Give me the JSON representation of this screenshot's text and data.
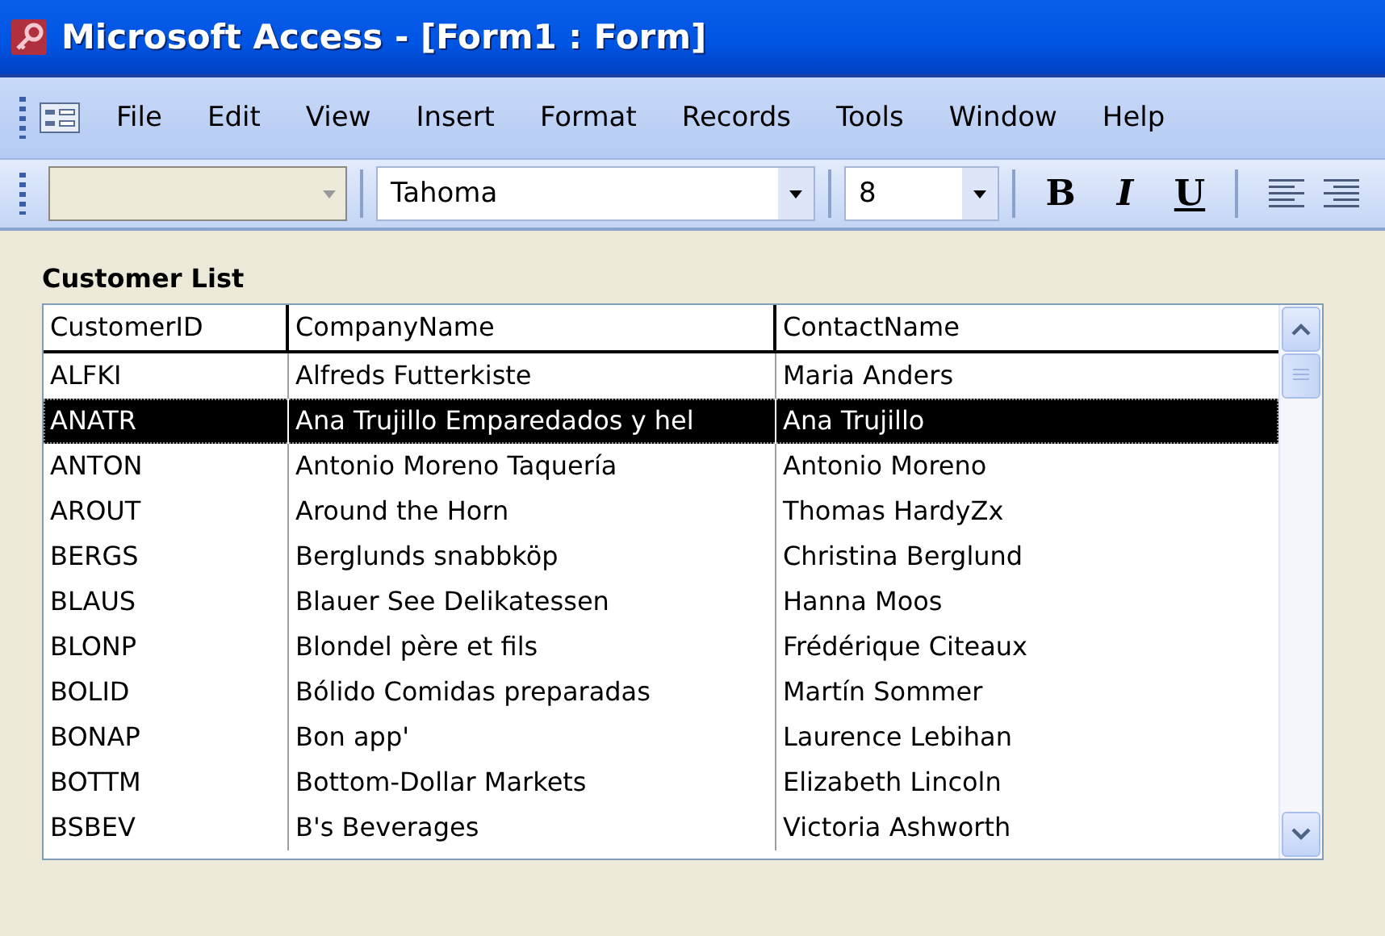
{
  "window": {
    "title": "Microsoft Access - [Form1 : Form]"
  },
  "menu": [
    "File",
    "Edit",
    "View",
    "Insert",
    "Format",
    "Records",
    "Tools",
    "Window",
    "Help"
  ],
  "toolbar": {
    "font_name": "Tahoma",
    "font_size": "8",
    "format_buttons": [
      {
        "label": "B",
        "kind": "bold"
      },
      {
        "label": "I",
        "kind": "italic"
      },
      {
        "label": "U",
        "kind": "underline"
      }
    ]
  },
  "form": {
    "label": "Customer List",
    "list": {
      "columns": [
        "CustomerID",
        "CompanyName",
        "ContactName"
      ],
      "rows": [
        {
          "cells": [
            "ALFKI",
            "Alfreds Futterkiste",
            "Maria Anders"
          ],
          "selected": false
        },
        {
          "cells": [
            "ANATR",
            "Ana Trujillo Emparedados y hel",
            "Ana Trujillo"
          ],
          "selected": true
        },
        {
          "cells": [
            "ANTON",
            "Antonio Moreno Taquería",
            "Antonio Moreno"
          ],
          "selected": false
        },
        {
          "cells": [
            "AROUT",
            "Around the Horn",
            "Thomas HardyZx"
          ],
          "selected": false
        },
        {
          "cells": [
            "BERGS",
            "Berglunds snabbköp",
            "Christina Berglund"
          ],
          "selected": false
        },
        {
          "cells": [
            "BLAUS",
            "Blauer See Delikatessen",
            "Hanna Moos"
          ],
          "selected": false
        },
        {
          "cells": [
            "BLONP",
            "Blondel père et fils",
            "Frédérique Citeaux"
          ],
          "selected": false
        },
        {
          "cells": [
            "BOLID",
            "Bólido Comidas preparadas",
            "Martín Sommer"
          ],
          "selected": false
        },
        {
          "cells": [
            "BONAP",
            "Bon app'",
            "Laurence Lebihan"
          ],
          "selected": false
        },
        {
          "cells": [
            "BOTTM",
            "Bottom-Dollar Markets",
            "Elizabeth Lincoln"
          ],
          "selected": false
        },
        {
          "cells": [
            "BSBEV",
            "B's Beverages",
            "Victoria Ashworth"
          ],
          "selected": false
        }
      ]
    }
  }
}
